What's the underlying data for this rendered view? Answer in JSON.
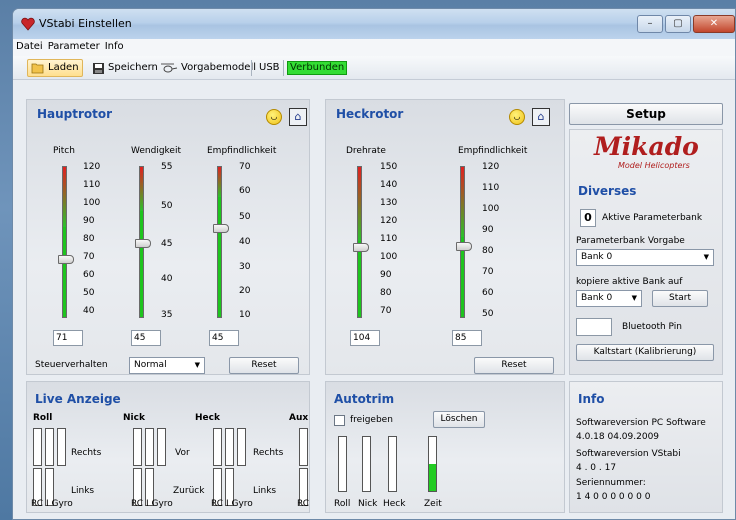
{
  "window": {
    "title": "VStabi Einstellen",
    "btn_min": "–",
    "btn_max": "▢",
    "btn_close": "✕"
  },
  "menu": [
    "Datei",
    "Parameter",
    "Info"
  ],
  "toolbar": {
    "load": "Laden",
    "save": "Speichern",
    "default_model": "Vorgabemodell",
    "usb": "USB",
    "status": "Verbunden"
  },
  "hauptrotor": {
    "title": "Hauptrotor",
    "pitch": {
      "label": "Pitch",
      "ticks": [
        "120",
        "110",
        "100",
        "90",
        "80",
        "70",
        "60",
        "50",
        "40"
      ],
      "value": "71"
    },
    "wendigkeit": {
      "label": "Wendigkeit",
      "ticks": [
        "55",
        "50",
        "45",
        "40",
        "35"
      ],
      "value": "45"
    },
    "empfindlichkeit": {
      "label": "Empfindlichkeit",
      "ticks": [
        "70",
        "60",
        "50",
        "40",
        "30",
        "20",
        "10"
      ],
      "value": "45"
    },
    "steuer_label": "Steuerverhalten",
    "steuer_value": "Normal",
    "reset": "Reset"
  },
  "heckrotor": {
    "title": "Heckrotor",
    "drehrate": {
      "label": "Drehrate",
      "ticks": [
        "150",
        "140",
        "130",
        "120",
        "110",
        "100",
        "90",
        "80",
        "70"
      ],
      "value": "104"
    },
    "empfindlichkeit": {
      "label": "Empfindlichkeit",
      "ticks": [
        "120",
        "110",
        "100",
        "90",
        "80",
        "70",
        "60",
        "50"
      ],
      "value": "85"
    },
    "reset": "Reset"
  },
  "setup": {
    "button": "Setup",
    "logo": "Mikado",
    "logo_sub": "Model Helicopters"
  },
  "diverses": {
    "title": "Diverses",
    "bank_num": "0",
    "aktive_label": "Aktive Parameterbank",
    "vorgabe_label": "Parameterbank Vorgabe",
    "vorgabe_value": "Bank 0",
    "kopiere_label": "kopiere aktive Bank auf",
    "kopiere_value": "Bank 0",
    "start": "Start",
    "bt_label": "Bluetooth Pin",
    "kaltstart": "Kaltstart (Kalibrierung)"
  },
  "live": {
    "title": "Live Anzeige",
    "roll": "Roll",
    "nick": "Nick",
    "heck": "Heck",
    "aux": "Aux",
    "rechts": "Rechts",
    "links": "Links",
    "vor": "Vor",
    "zurueck": "Zurück",
    "rc_gyro": "RC I Gyro",
    "rc": "RC"
  },
  "autotrim": {
    "title": "Autotrim",
    "freigeben": "freigeben",
    "loeschen": "Löschen",
    "roll": "Roll",
    "nick": "Nick",
    "heck": "Heck",
    "zeit": "Zeit",
    "zeit_level": 0.5
  },
  "info": {
    "title": "Info",
    "pc_label": "Softwareversion PC Software",
    "pc_value": "4.0.18 04.09.2009",
    "vstabi_label": "Softwareversion VStabi",
    "vstabi_value": "4 . 0 . 17",
    "serial_label": "Seriennummer:",
    "serial_value": "1 4 0 0 0 0 0 0 0"
  }
}
